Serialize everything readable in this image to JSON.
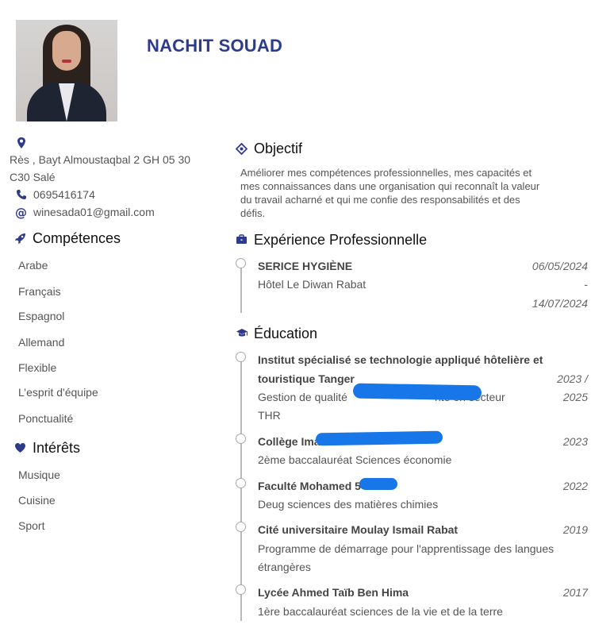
{
  "header": {
    "name": "NACHIT SOUAD"
  },
  "contact": {
    "address_line1": "Rès , Bayt Almoustaqbal 2 GH 05 30",
    "address_line2": "C30 Salé",
    "phone": "0695416174",
    "email": "winesada01@gmail.com"
  },
  "skills": {
    "title": "Compétences",
    "items": [
      "Arabe",
      "Français",
      "Espagnol",
      "Allemand",
      "Flexible",
      "L’esprit d'équipe",
      "Ponctualité"
    ]
  },
  "interests": {
    "title": "Intérêts",
    "items": [
      "Musique",
      "Cuisine",
      "Sport"
    ]
  },
  "objective": {
    "title": "Objectif",
    "lines": [
      "Améliorer mes compétences professionnelles, mes capacités et",
      "mes connaissances dans une organisation qui reconnaît la valeur",
      "du travail acharné et qui me confie des responsabilités et des",
      "défis."
    ]
  },
  "experience": {
    "title": "Expérience Professionnelle",
    "items": [
      {
        "title": "SERICE HYGIÈNE",
        "place": "Hôtel Le Diwan Rabat",
        "date_start": "06/05/2024",
        "date_sep": "-",
        "date_end": "14/07/2024"
      }
    ]
  },
  "education": {
    "title": "Éducation",
    "items": [
      {
        "title_line1": "Institut spécialisé se technologie appliqué hôtelière et",
        "title_line2": "touristique Tanger",
        "sub_line1": "Gestion de qualité",
        "sub_line1_end": "nte en secteur",
        "sub_line2": "THR",
        "date_line1": "2023 /",
        "date_line2": "2025"
      },
      {
        "title": "Collège Imam",
        "sub": "2ème baccalauréat Sciences économie",
        "date": "2023"
      },
      {
        "title": "Faculté Mohamed 5",
        "sub": "Deug sciences des matières chimies",
        "date": "2022"
      },
      {
        "title": "Cité universitaire Moulay Ismail Rabat",
        "sub_line1": "Programme de démarrage pour l'apprentissage des langues",
        "sub_line2": "étrangères",
        "date": "2019"
      },
      {
        "title": "Lycée Ahmed Taïb Ben Hima",
        "sub": "1ère baccalauréat sciences de la vie et de la terre",
        "date": "2017"
      }
    ]
  },
  "colors": {
    "accent": "#2e3a8c",
    "redaction": "#1877e8"
  }
}
